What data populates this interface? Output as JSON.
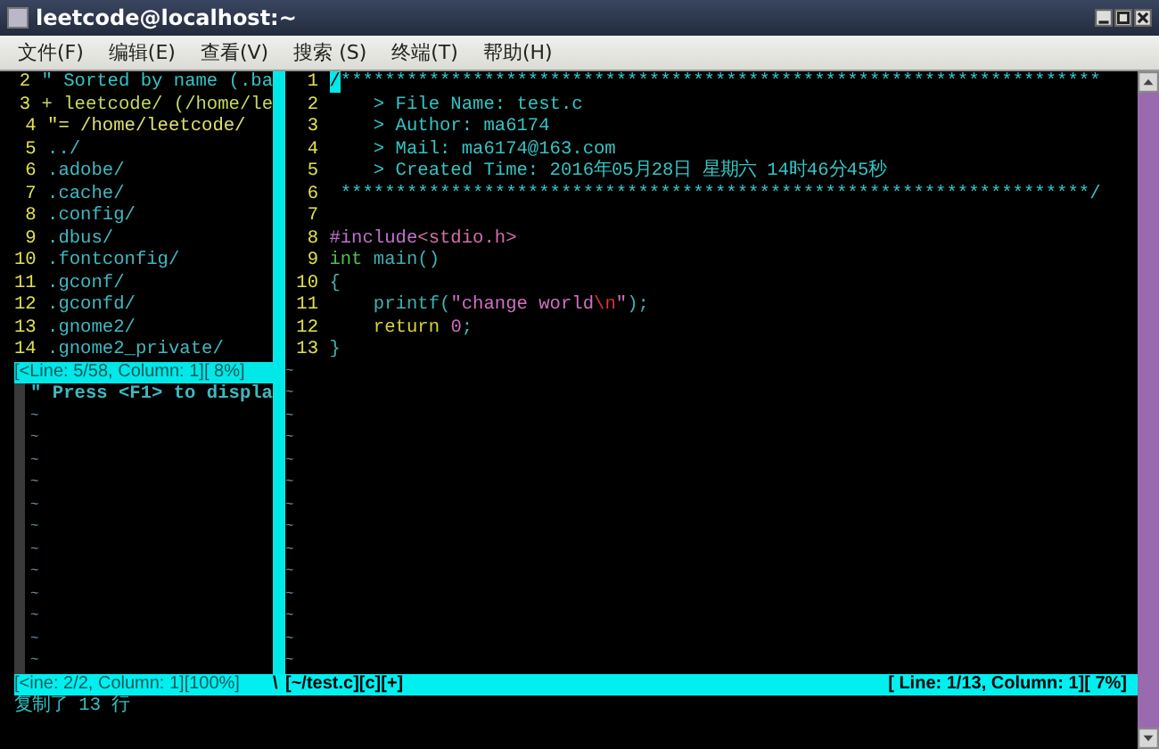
{
  "window": {
    "title": "leetcode@localhost:~"
  },
  "menu": [
    {
      "label": "文件(F)"
    },
    {
      "label": "编辑(E)"
    },
    {
      "label": "查看(V)"
    },
    {
      "label": "搜索 (S)"
    },
    {
      "label": "终端(T)"
    },
    {
      "label": "帮助(H)"
    }
  ],
  "left_pane": {
    "lines": [
      {
        "number": "2",
        "segments": [
          {
            "text": "\" Sorted by name (.ba",
            "kind": "comment"
          }
        ]
      },
      {
        "number": "3",
        "segments": [
          {
            "text": "+ leetcode/ (/home/le",
            "kind": "root"
          }
        ]
      },
      {
        "number": "4",
        "segments": [
          {
            "text": "\"= /home/leetcode/",
            "kind": "path"
          }
        ]
      },
      {
        "number": "5",
        "segments": [
          {
            "text": "../",
            "kind": "dir"
          }
        ]
      },
      {
        "number": "6",
        "segments": [
          {
            "text": ".adobe/",
            "kind": "dir"
          }
        ]
      },
      {
        "number": "7",
        "segments": [
          {
            "text": ".cache/",
            "kind": "dir"
          }
        ]
      },
      {
        "number": "8",
        "segments": [
          {
            "text": ".config/",
            "kind": "dir"
          }
        ]
      },
      {
        "number": "9",
        "segments": [
          {
            "text": ".dbus/",
            "kind": "dir"
          }
        ]
      },
      {
        "number": "10",
        "segments": [
          {
            "text": ".fontconfig/",
            "kind": "dir"
          }
        ]
      },
      {
        "number": "11",
        "segments": [
          {
            "text": ".gconf/",
            "kind": "dir"
          }
        ]
      },
      {
        "number": "12",
        "segments": [
          {
            "text": ".gconfd/",
            "kind": "dir"
          }
        ]
      },
      {
        "number": "13",
        "segments": [
          {
            "text": ".gnome2/",
            "kind": "dir"
          }
        ]
      },
      {
        "number": "14",
        "segments": [
          {
            "text": ".gnome2_private/",
            "kind": "dir"
          }
        ]
      }
    ],
    "status": "[<Line: 5/58, Column: 1][ 8%]",
    "help": "\" Press <F1> to displa",
    "empty_lines": [
      "~",
      "~",
      "~",
      "~",
      "~",
      "~",
      "~",
      "~",
      "~",
      "~",
      "~",
      "~"
    ]
  },
  "right_pane": {
    "lines": [
      {
        "number": "1",
        "segments": [
          {
            "text": "/",
            "kind": "cursor"
          },
          {
            "text": "*********************************************************************",
            "kind": "comment"
          }
        ]
      },
      {
        "number": "2",
        "segments": [
          {
            "text": "    > File Name: test.c",
            "kind": "comment"
          }
        ]
      },
      {
        "number": "3",
        "segments": [
          {
            "text": "    > Author: ma6174",
            "kind": "comment"
          }
        ]
      },
      {
        "number": "4",
        "segments": [
          {
            "text": "    > Mail: ma6174@163.com",
            "kind": "comment"
          }
        ]
      },
      {
        "number": "5",
        "segments": [
          {
            "text": "    > Created Time: 2016年05月28日 星期六 14时46分45秒",
            "kind": "comment"
          }
        ]
      },
      {
        "number": "6",
        "segments": [
          {
            "text": " ********************************************************************/",
            "kind": "comment"
          }
        ]
      },
      {
        "number": "7"
      },
      {
        "number": "8",
        "segments": [
          {
            "text": "#include",
            "kind": "preproc"
          },
          {
            "text": "<stdio.h>",
            "kind": "include"
          }
        ]
      },
      {
        "number": "9",
        "segments": [
          {
            "text": "int",
            "kind": "type"
          },
          {
            "text": " main()",
            "kind": "plain"
          }
        ]
      },
      {
        "number": "10",
        "segments": [
          {
            "text": "{",
            "kind": "plain"
          }
        ]
      },
      {
        "number": "11",
        "segments": [
          {
            "text": "    printf(",
            "kind": "plain"
          },
          {
            "text": "\"change world",
            "kind": "string"
          },
          {
            "text": "\\n",
            "kind": "escape"
          },
          {
            "text": "\"",
            "kind": "string"
          },
          {
            "text": ");",
            "kind": "plain"
          }
        ]
      },
      {
        "number": "12",
        "segments": [
          {
            "text": "    return ",
            "kind": "keyword"
          },
          {
            "text": "0",
            "kind": "string"
          },
          {
            "text": ";",
            "kind": "plain"
          }
        ]
      },
      {
        "number": "13",
        "segments": [
          {
            "text": "}",
            "kind": "plain"
          }
        ]
      }
    ],
    "empty_lines": [
      "~",
      "~",
      "~",
      "~",
      "~",
      "~",
      "~",
      "~",
      "~",
      "~",
      "~",
      "~",
      "~",
      "~"
    ]
  },
  "status_bar": {
    "left": "[<ine: 2/2, Column: 1][100%]",
    "separator": "\\",
    "file": "[~/test.c][c][+]",
    "position": "[ Line: 1/13, Column: 1][ 7%]"
  },
  "message": "复制了 13 行"
}
